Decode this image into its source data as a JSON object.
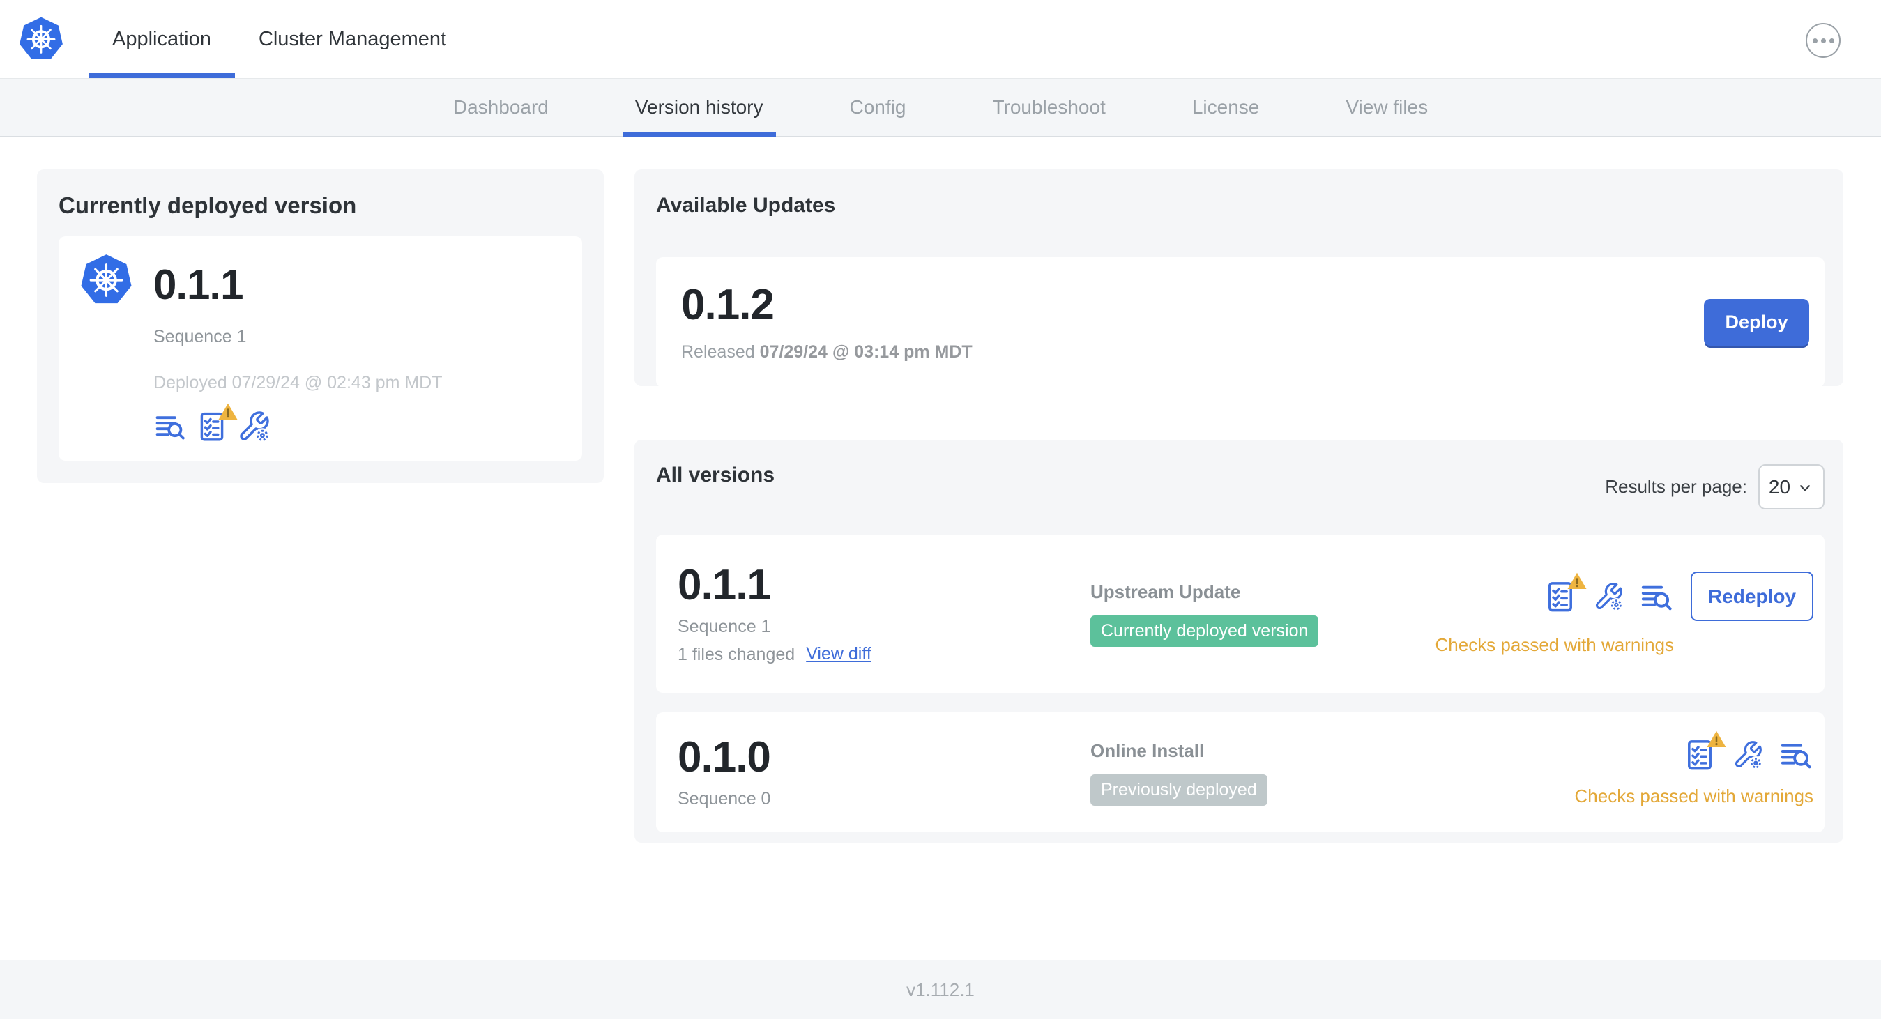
{
  "header": {
    "app_tab": "Application",
    "cluster_tab": "Cluster Management"
  },
  "nav": {
    "tabs": [
      "Dashboard",
      "Version history",
      "Config",
      "Troubleshoot",
      "License",
      "View files"
    ],
    "active_tab": "Version history"
  },
  "current_version": {
    "title": "Currently deployed version",
    "version": "0.1.1",
    "sequence": "Sequence 1",
    "deployed": "Deployed 07/29/24 @ 02:43 pm MDT"
  },
  "available_updates": {
    "title": "Available Updates",
    "version": "0.1.2",
    "released_prefix": "Released",
    "released_date": "07/29/24 @ 03:14 pm MDT",
    "deploy_label": "Deploy"
  },
  "all_versions": {
    "title": "All versions",
    "results_per_page_label": "Results per page:",
    "results_per_page_value": "20",
    "rows": [
      {
        "version": "0.1.1",
        "sequence": "Sequence 1",
        "files_changed": "1 files changed",
        "view_diff_label": "View diff",
        "source": "Upstream Update",
        "status_badge": "Currently deployed version",
        "checks_text": "Checks passed with warnings",
        "action_label": "Redeploy"
      },
      {
        "version": "0.1.0",
        "sequence": "Sequence 0",
        "source": "Online Install",
        "status_badge": "Previously deployed",
        "checks_text": "Checks passed with warnings"
      }
    ]
  },
  "footer": {
    "app_version": "v1.112.1"
  },
  "colors": {
    "accent_blue": "#3e6cd9",
    "kubernetes_blue": "#326de6",
    "badge_green": "#5cc19b",
    "badge_gray": "#bfc8ca",
    "warning_amber": "#e3a838",
    "warning_triangle": "#eeb440",
    "panel_gray": "#f5f6f8"
  },
  "icons": {
    "logo": "kubernetes-logo",
    "header_right": "more-options-icon",
    "current_card": [
      "deploy-logs-icon",
      "preflight-checks-warning-icon",
      "edit-config-icon"
    ],
    "row_actions": [
      "preflight-checks-warning-icon",
      "edit-config-icon",
      "deploy-logs-icon"
    ],
    "results_select": "chevron-down-icon"
  }
}
